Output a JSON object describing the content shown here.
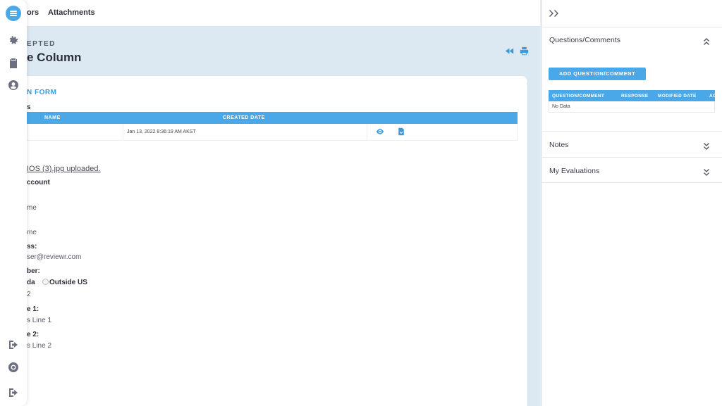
{
  "topbar": {
    "tab_partial": "ors",
    "tab_attachments": "Attachments"
  },
  "header": {
    "status": "EPTED",
    "title": "e Column"
  },
  "form": {
    "title": "N FORM",
    "section_label": "s",
    "attachments_table": {
      "columns": [
        "NAME",
        "CREATED DATE"
      ],
      "rows": [
        {
          "name": "",
          "created": "Jan 13, 2022 8:36:19 AM AKST"
        }
      ]
    },
    "upload_text": "IOS (3).jpg uploaded.",
    "fields": [
      {
        "label": "ccount",
        "value": ""
      },
      {
        "label": "",
        "value": "me"
      },
      {
        "label": "",
        "value": "me"
      },
      {
        "label": "ss:",
        "value": "ser@reviewr.com"
      },
      {
        "label": "ber:",
        "value": ""
      }
    ],
    "radio_inside_partial": "da",
    "radio_outside": "Outside US",
    "number_value": "2",
    "line1_label": "e 1:",
    "line1_value": "s Line 1",
    "line2_label": "e 2:",
    "line2_value": "s Line 2"
  },
  "right_panel": {
    "questions": {
      "label": "Questions/Comments",
      "add_button": "ADD QUESTION/COMMENT",
      "columns": [
        "QUESTION/COMMENT",
        "RESPONSE",
        "MODIFIED DATE",
        "AC"
      ],
      "empty": "No Data"
    },
    "notes_label": "Notes",
    "evaluations_label": "My Evaluations"
  },
  "colors": {
    "accent": "#4aa8e8",
    "background": "#dde9f2"
  }
}
